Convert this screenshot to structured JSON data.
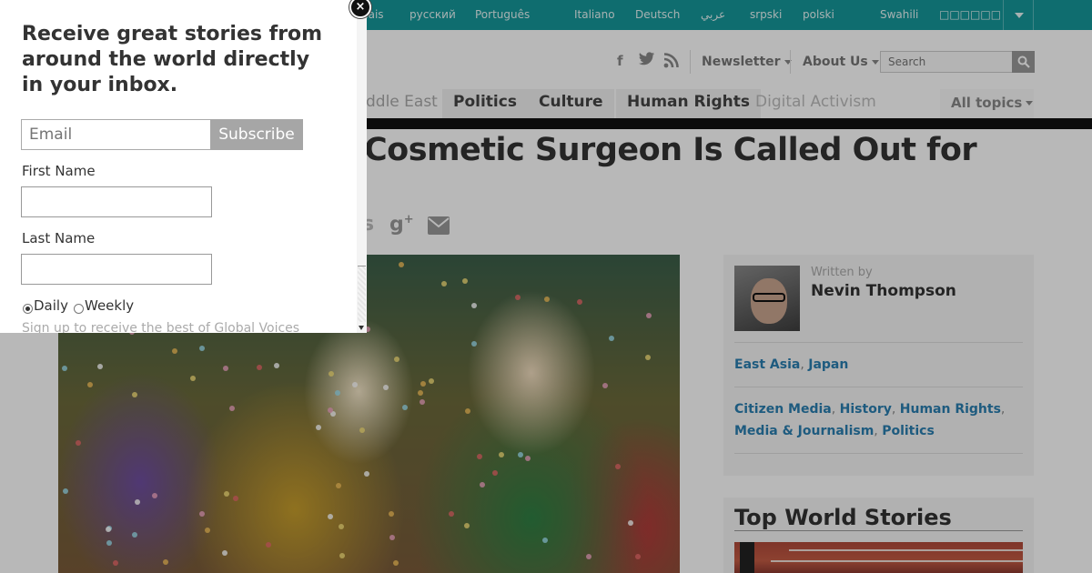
{
  "languages": [
    {
      "label": "çais"
    },
    {
      "label": "русский"
    },
    {
      "label": "Português"
    },
    {
      "label": "Italiano"
    },
    {
      "label": "Deutsch"
    },
    {
      "label": "عربي"
    },
    {
      "label": "srpski"
    },
    {
      "label": "polski"
    },
    {
      "label": "Swahili"
    },
    {
      "label": "□□□□□□"
    }
  ],
  "header": {
    "social_icons": [
      "facebook-icon",
      "twitter-icon",
      "rss-icon"
    ],
    "newsletter_label": "Newsletter",
    "about_label": "About Us",
    "search_placeholder": "Search"
  },
  "topics": [
    {
      "label": "ddle East"
    },
    {
      "label": "Politics"
    },
    {
      "label": "Culture"
    },
    {
      "label": "Human Rights"
    },
    {
      "label": "Digital Activism"
    },
    {
      "label": "All topics"
    }
  ],
  "article": {
    "headline": "Cosmetic Surgeon Is Called Out for"
  },
  "author_box": {
    "written_by": "Written by",
    "name": "Nevin Thompson",
    "regions": [
      "East Asia",
      "Japan"
    ],
    "categories_line1": [
      "Citizen Media",
      "History",
      "Human Rights"
    ],
    "categories_line2": [
      "Media & Journalism",
      "Politics"
    ]
  },
  "top_world_stories": {
    "title": "Top World Stories"
  },
  "popup": {
    "title": "Receive great stories from around the world directly in your inbox.",
    "email_placeholder": "Email",
    "subscribe_label": "Subscribe",
    "first_name_label": "First Name",
    "last_name_label": "Last Name",
    "frequency_options": [
      "Daily",
      "Weekly"
    ],
    "frequency_selected": "Daily",
    "note": "Sign up to receive the best of Global Voices",
    "close_label": "×"
  },
  "colors": {
    "lang_bar": "#16979a",
    "link": "#2a7fb0",
    "subscribe_button": "#a6a6a6"
  }
}
